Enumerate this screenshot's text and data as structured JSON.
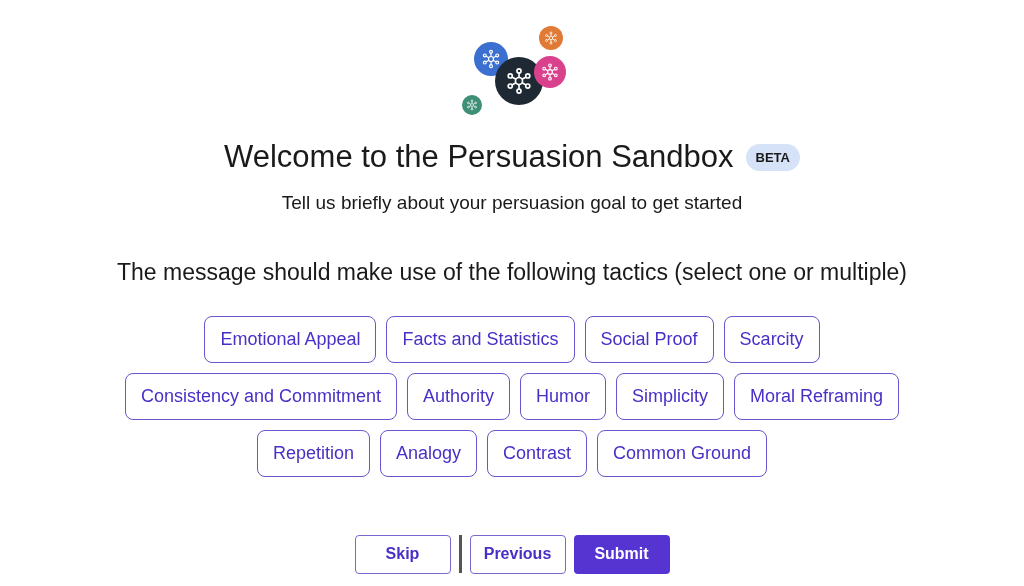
{
  "header": {
    "title": "Welcome to the Persuasion Sandbox",
    "badge": "BETA",
    "subtitle": "Tell us briefly about your persuasion goal to get started"
  },
  "question": "The message should make use of the following tactics (select one or multiple)",
  "tactic_rows": [
    [
      {
        "label": "Emotional Appeal",
        "selected": false
      },
      {
        "label": "Facts and Statistics",
        "selected": false
      },
      {
        "label": "Social Proof",
        "selected": false
      },
      {
        "label": "Scarcity",
        "selected": false
      }
    ],
    [
      {
        "label": "Consistency and Commitment",
        "selected": false
      },
      {
        "label": "Authority",
        "selected": false
      },
      {
        "label": "Humor",
        "selected": false
      },
      {
        "label": "Simplicity",
        "selected": false
      },
      {
        "label": "Moral Reframing",
        "selected": false
      }
    ],
    [
      {
        "label": "Repetition",
        "selected": false
      },
      {
        "label": "Analogy",
        "selected": false
      },
      {
        "label": "Contrast",
        "selected": false
      },
      {
        "label": "Common Ground",
        "selected": false
      }
    ]
  ],
  "buttons": [
    {
      "label": "Skip",
      "kind": "outline"
    },
    {
      "kind": "divider"
    },
    {
      "label": "Previous",
      "kind": "outline"
    },
    {
      "label": "Submit",
      "kind": "primary"
    }
  ]
}
